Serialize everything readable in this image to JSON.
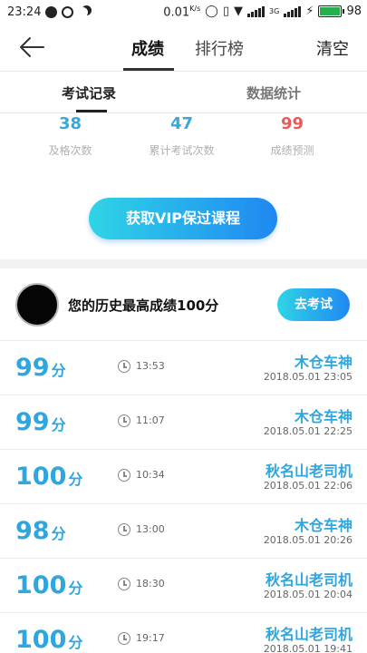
{
  "status_bar": {
    "time": "23:24",
    "speed": "0.01",
    "speed_unit": "K/s",
    "network": "3G",
    "battery": "98"
  },
  "nav": {
    "tabs": [
      {
        "label": "成绩"
      },
      {
        "label": "排行榜"
      }
    ],
    "active_tab": "成绩",
    "clear_label": "清空"
  },
  "subtabs": [
    {
      "label": "考试记录"
    },
    {
      "label": "数据统计"
    }
  ],
  "stats": [
    {
      "value": "38",
      "label": "及格次数"
    },
    {
      "value": "47",
      "label": "累计考试次数"
    },
    {
      "value": "99",
      "label": "成绩预测"
    }
  ],
  "vip_button": "获取VIP保过课程",
  "best": {
    "text": "您的历史最高成绩100分",
    "exam_button": "去考试"
  },
  "records": [
    {
      "score": "99",
      "unit": "分",
      "time": "13:53",
      "name": "木仓车神",
      "date": "2018.05.01  23:05"
    },
    {
      "score": "99",
      "unit": "分",
      "time": "11:07",
      "name": "木仓车神",
      "date": "2018.05.01  22:25"
    },
    {
      "score": "100",
      "unit": "分",
      "time": "10:34",
      "name": "秋名山老司机",
      "date": "2018.05.01  22:06"
    },
    {
      "score": "98",
      "unit": "分",
      "time": "13:00",
      "name": "木仓车神",
      "date": "2018.05.01  20:26"
    },
    {
      "score": "100",
      "unit": "分",
      "time": "18:30",
      "name": "秋名山老司机",
      "date": "2018.05.01  20:04"
    },
    {
      "score": "100",
      "unit": "分",
      "time": "19:17",
      "name": "秋名山老司机",
      "date": "2018.05.01  19:41"
    }
  ],
  "colors": {
    "accent": "#2ea6e0",
    "prediction": "#e85b5b",
    "gradient_start": "#2fd4e6",
    "gradient_end": "#1f88f2"
  }
}
